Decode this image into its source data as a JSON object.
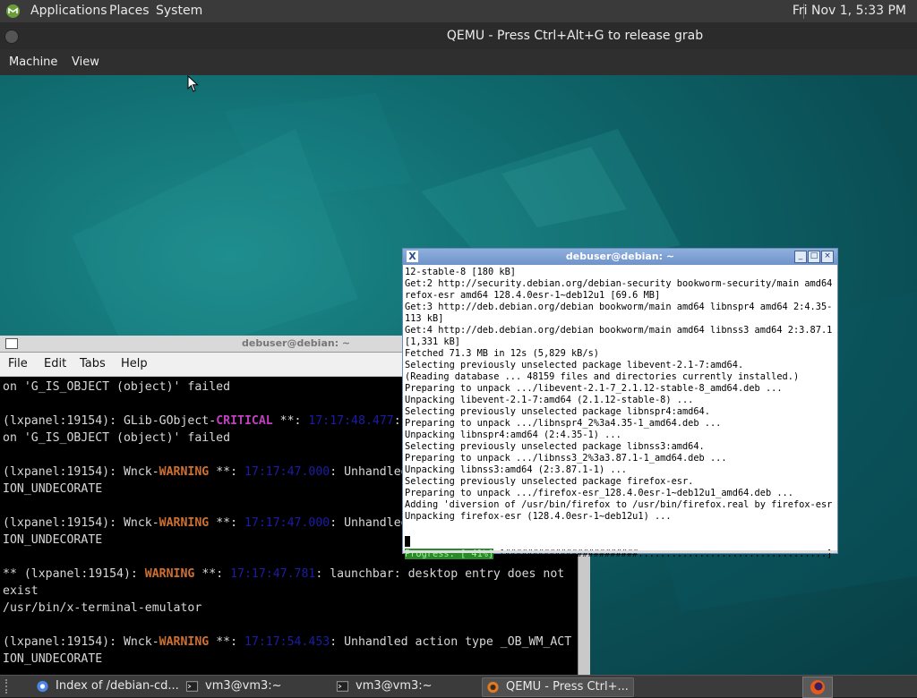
{
  "host_panel": {
    "menus": [
      "Applications",
      "Places",
      "System"
    ],
    "clock": "Fri Nov 1,  5:33 PM"
  },
  "qemu": {
    "title": "QEMU - Press Ctrl+Alt+G to release grab",
    "menus": [
      "Machine",
      "View"
    ]
  },
  "left_terminal": {
    "title": "debuser@debian: ~",
    "menus": [
      "File",
      "Edit",
      "Tabs",
      "Help"
    ],
    "lines": [
      [
        {
          "t": "on 'G_IS_OBJECT (object)' failed",
          "c": ""
        }
      ],
      [
        {
          "t": "",
          "c": ""
        }
      ],
      [
        {
          "t": "(lxpanel:19154): GLib-GObject-",
          "c": ""
        },
        {
          "t": "CRITICAL",
          "c": "crit"
        },
        {
          "t": " **: ",
          "c": ""
        },
        {
          "t": "17:17:48.477",
          "c": "ts"
        },
        {
          "t": ": g_object_unref: assertion",
          "c": ""
        }
      ],
      [
        {
          "t": "on 'G_IS_OBJECT (object)' failed",
          "c": ""
        }
      ],
      [
        {
          "t": "",
          "c": ""
        }
      ],
      [
        {
          "t": "(lxpanel:19154): Wnck-",
          "c": ""
        },
        {
          "t": "WARNING",
          "c": "warn"
        },
        {
          "t": " **: ",
          "c": ""
        },
        {
          "t": "17:17:47.000",
          "c": "ts"
        },
        {
          "t": ": Unhandled action type _OB_WM_ACT",
          "c": ""
        }
      ],
      [
        {
          "t": "ION_UNDECORATE",
          "c": ""
        }
      ],
      [
        {
          "t": "",
          "c": ""
        }
      ],
      [
        {
          "t": "(lxpanel:19154): Wnck-",
          "c": ""
        },
        {
          "t": "WARNING",
          "c": "warn"
        },
        {
          "t": " **: ",
          "c": ""
        },
        {
          "t": "17:17:47.000",
          "c": "ts"
        },
        {
          "t": ": Unhandled action type _OB_WM_ACT",
          "c": ""
        }
      ],
      [
        {
          "t": "ION_UNDECORATE",
          "c": ""
        }
      ],
      [
        {
          "t": "",
          "c": ""
        }
      ],
      [
        {
          "t": "** (lxpanel:19154): ",
          "c": ""
        },
        {
          "t": "WARNING",
          "c": "warn"
        },
        {
          "t": " **: ",
          "c": ""
        },
        {
          "t": "17:17:47.781",
          "c": "ts"
        },
        {
          "t": ": launchbar: desktop entry does not",
          "c": ""
        }
      ],
      [
        {
          "t": "exist",
          "c": ""
        }
      ],
      [
        {
          "t": "/usr/bin/x-terminal-emulator",
          "c": ""
        }
      ],
      [
        {
          "t": "",
          "c": ""
        }
      ],
      [
        {
          "t": "(lxpanel:19154): Wnck-",
          "c": ""
        },
        {
          "t": "WARNING",
          "c": "warn"
        },
        {
          "t": " **: ",
          "c": ""
        },
        {
          "t": "17:17:54.453",
          "c": "ts"
        },
        {
          "t": ": Unhandled action type _OB_WM_ACT",
          "c": ""
        }
      ],
      [
        {
          "t": "ION_UNDECORATE",
          "c": ""
        }
      ]
    ]
  },
  "right_terminal": {
    "title": "debuser@debian: ~",
    "lines": [
      "12-stable-8 [180 kB]",
      "Get:2 http://security.debian.org/debian-security bookworm-security/main amd64 fi",
      "refox-esr amd64 128.4.0esr-1~deb12u1 [69.6 MB]",
      "Get:3 http://deb.debian.org/debian bookworm/main amd64 libnspr4 amd64 2:4.35-1 [",
      "113 kB]",
      "Get:4 http://deb.debian.org/debian bookworm/main amd64 libnss3 amd64 2:3.87.1-1",
      "[1,331 kB]",
      "Fetched 71.3 MB in 12s (5,829 kB/s)",
      "Selecting previously unselected package libevent-2.1-7:amd64.",
      "(Reading database ... 48159 files and directories currently installed.)",
      "Preparing to unpack .../libevent-2.1-7_2.1.12-stable-8_amd64.deb ...",
      "Unpacking libevent-2.1-7:amd64 (2.1.12-stable-8) ...",
      "Selecting previously unselected package libnspr4:amd64.",
      "Preparing to unpack .../libnspr4_2%3a4.35-1_amd64.deb ...",
      "Unpacking libnspr4:amd64 (2:4.35-1) ...",
      "Selecting previously unselected package libnss3:amd64.",
      "Preparing to unpack .../libnss3_2%3a3.87.1-1_amd64.deb ...",
      "Unpacking libnss3:amd64 (2:3.87.1-1) ...",
      "Selecting previously unselected package firefox-esr.",
      "Preparing to unpack .../firefox-esr_128.4.0esr-1~deb12u1_amd64.deb ...",
      "Adding 'diversion of /usr/bin/firefox to /usr/bin/firefox.real by firefox-esr'",
      "Unpacking firefox-esr (128.4.0esr-1~deb12u1) ..."
    ],
    "progress_label": "Progress: [ 41%]",
    "progress_bar": " [########################..................................]",
    "progress_percent": 41
  },
  "guest_taskbar": {
    "tasks": [
      {
        "label": "Index of /debian-cd...",
        "icon": "chromium-icon"
      },
      {
        "label": "vm3@vm3:~",
        "icon": "terminal-icon"
      },
      {
        "label": "vm3@vm3:~",
        "icon": "terminal-icon"
      },
      {
        "label": "QEMU - Press Ctrl+...",
        "icon": "qemu-icon"
      }
    ]
  },
  "colors": {
    "critical": "#c040c0",
    "warning": "#d07030",
    "timestamp": "#1c1ca8",
    "progress_bg": "#2a8a2a",
    "xterm_titlebar": "#7fa1d3"
  }
}
